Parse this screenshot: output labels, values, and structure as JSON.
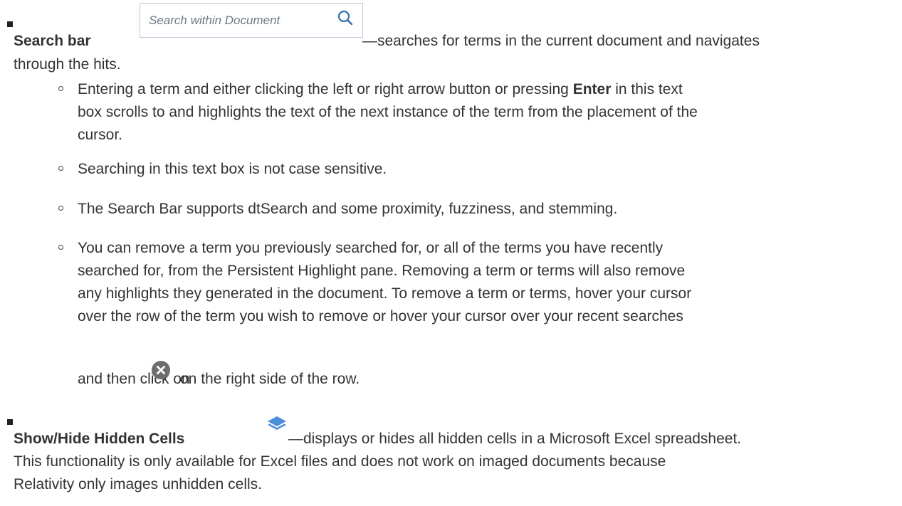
{
  "search_bar_item": {
    "title": "Search bar",
    "search_placeholder": "Search within Document",
    "search_icon": "search-icon",
    "description_line1": "—searches for terms in the current document and navigates",
    "description_line2": "through the hits.",
    "sub_items": {
      "enter": {
        "line1_pre": "Entering a term and either clicking the left or right arrow button or pressing ",
        "line1_bold": "Enter",
        "line1_post": " in this text",
        "line2": "box scrolls to and highlights the text of the next instance of the term from the placement of the",
        "line3": "cursor."
      },
      "case": "Searching in this text box is not case sensitive.",
      "dtsearch": "The Search Bar supports dtSearch and some proximity, fuzziness, and stemming.",
      "remove": {
        "line1": "You can remove a term you previously searched for, or all of the terms you have recently",
        "line2": "searched for, from the Persistent Highlight pane. Removing a term or terms will also remove",
        "line3": "any highlights they generated in the document. To remove a term or terms, hover your cursor",
        "line4": "over the row of the term you wish to remove or hover your cursor over your recent searches",
        "line5_pre": "and then click on ",
        "line5_post": " on the right side of the row.",
        "icon": "clear-x-circle-icon"
      }
    }
  },
  "hidden_cells_item": {
    "title": "Show/Hide Hidden Cells",
    "icon": "layers-icon",
    "line1": "—displays or hides all hidden cells in a Microsoft Excel spreadsheet.",
    "line2": "This functionality is only available for Excel files and does not work on imaged documents because",
    "line3": "Relativity only images unhidden cells."
  },
  "colors": {
    "text": "#333333",
    "search_icon": "#2f6fb3",
    "layers_icon": "#4a90d9",
    "clear_icon": "#6e6e6e"
  }
}
